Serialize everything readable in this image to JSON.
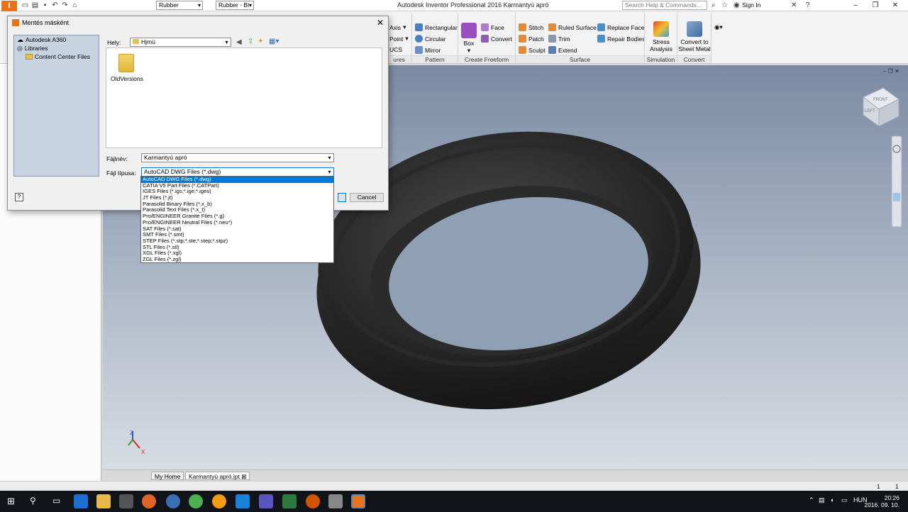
{
  "window": {
    "title": "Autodesk Inventor Professional 2016    Karmantyú apró",
    "material": "Rubber",
    "appearance": "Rubber - Bl",
    "search_placeholder": "Search Help & Commands...",
    "sign_in": "Sign In"
  },
  "ribbon": {
    "work_features": {
      "axis": "Axis",
      "point": "Point",
      "ucs": "UCS",
      "label": "ures"
    },
    "pattern": {
      "items": [
        "Rectangular",
        "Circular",
        "Mirror"
      ],
      "label": "Pattern"
    },
    "create_freeform": {
      "box": "Box",
      "face": "Face",
      "convert": "Convert",
      "label": "Create Freeform"
    },
    "surface": {
      "items": [
        "Stitch",
        "Patch",
        "Sculpt",
        "Ruled Surface",
        "Trim",
        "Extend",
        "Replace Face",
        "Repair Bodies"
      ],
      "label": "Surface"
    },
    "simulation": {
      "button": "Stress Analysis",
      "label": "Simulation"
    },
    "convert": {
      "button": "Convert to Sheet Metal",
      "label": "Convert"
    }
  },
  "dialog": {
    "title": "Mentés másként",
    "places": [
      "Autodesk A360",
      "Libraries",
      "Content Center Files"
    ],
    "location_label": "Hely:",
    "location_value": "Hjmü",
    "files": [
      "OldVersions"
    ],
    "filename_label": "Fájlnév:",
    "filename_value": "Karmantyú apró",
    "filetype_label": "Fájl típusa:",
    "filetype_value": "AutoCAD DWG Files (*.dwg)",
    "cancel": "Cancel",
    "help": "?",
    "filetype_options": [
      "AutoCAD DWG Files (*.dwg)",
      "CATIA V5 Part Files (*.CATPart)",
      "IGES Files (*.igs;*.ige;*.iges)",
      "JT Files (*.jt)",
      "Parasolid Binary Files (*.x_b)",
      "Parasolid Text Files (*.x_t)",
      "Pro/ENGINEER Granite Files (*.g)",
      "Pro/ENGINEER Neutral Files (*.neu*)",
      "SAT Files (*.sat)",
      "SMT Files (*.smt)",
      "STEP Files (*.stp;*.ste;*.step;*.stpz)",
      "STL Files (*.stl)",
      "XGL Files (*.xgl)",
      "ZGL Files (*.zgl)"
    ],
    "selected_index": 0
  },
  "viewcube": {
    "face_top": "FRONT",
    "face_side": "LEFT"
  },
  "triad": {
    "x": "X",
    "z": "Z"
  },
  "doc_tabs": [
    "My Home",
    "Karmantyú apró.ipt"
  ],
  "status": {
    "left_count": "1",
    "right_count": "1"
  },
  "taskbar": {
    "language": "HUN",
    "time": "20:26",
    "date": "2016. 09. 10."
  },
  "colors": {
    "selection": "#0078d7",
    "places_bg": "#c7d3e0",
    "taskbar_bg": "#101418"
  }
}
